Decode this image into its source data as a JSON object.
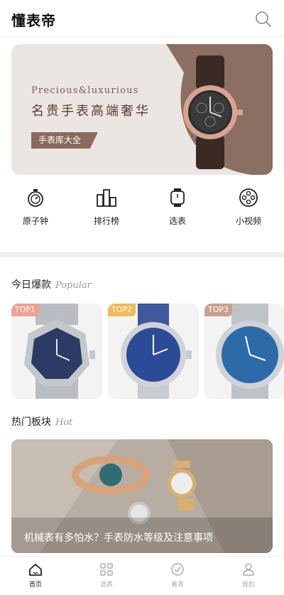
{
  "header": {
    "title": "懂表帝",
    "search_icon": "search-icon"
  },
  "banner": {
    "en_text": "Precious&luxurious",
    "cn_text": "名贵手表高端奢华",
    "button_label": "手表库大全",
    "colors": {
      "bg": "#ece6e2",
      "accent": "#8a6a5f",
      "shape": "#8b6f63"
    }
  },
  "nav": [
    {
      "label": "原子钟",
      "icon": "stopwatch-icon"
    },
    {
      "label": "排行榜",
      "icon": "ranking-icon"
    },
    {
      "label": "选表",
      "icon": "watch-select-icon"
    },
    {
      "label": "小视频",
      "icon": "film-reel-icon"
    }
  ],
  "popular": {
    "title": "今日爆款",
    "subtitle": "Popular",
    "items": [
      {
        "badge": "TOP1",
        "badge_color": "#f0a08e"
      },
      {
        "badge": "TOP2",
        "badge_color": "#f3b95a"
      },
      {
        "badge": "TOP3",
        "badge_color": "#c9a08e"
      }
    ]
  },
  "hot": {
    "title": "热门板块",
    "subtitle": "Hot",
    "caption": "机械表有多怕水？手表防水等级及注意事项"
  },
  "tabbar": [
    {
      "label": "首页",
      "icon": "home-icon",
      "active": true
    },
    {
      "label": "选表",
      "icon": "grid-icon",
      "active": false
    },
    {
      "label": "看表",
      "icon": "watch-face-icon",
      "active": false
    },
    {
      "label": "我的",
      "icon": "user-icon",
      "active": false
    }
  ]
}
